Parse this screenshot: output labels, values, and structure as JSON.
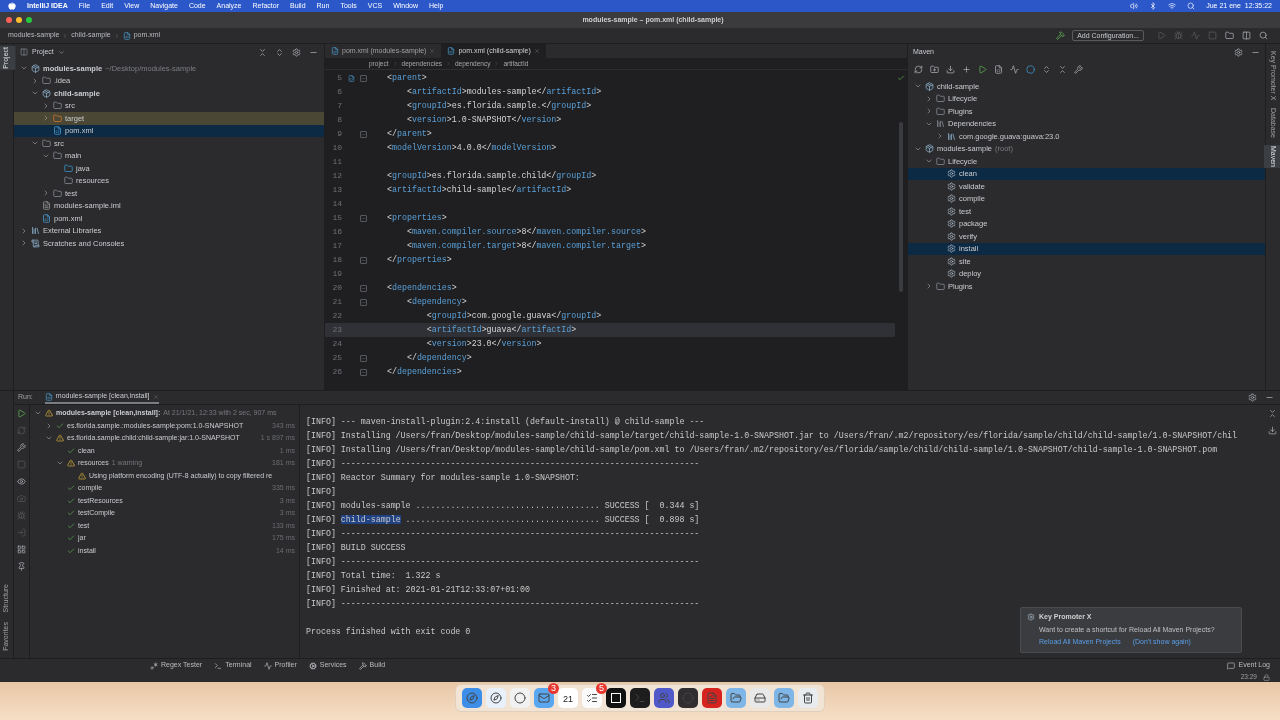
{
  "menubar": {
    "app": "IntelliJ IDEA",
    "menus": [
      "File",
      "Edit",
      "View",
      "Navigate",
      "Code",
      "Analyze",
      "Refactor",
      "Build",
      "Run",
      "Tools",
      "VCS",
      "Window",
      "Help"
    ],
    "clock": "Jue 21 ene  12:35:22"
  },
  "window": {
    "title": "modules-sample – pom.xml (child-sample)"
  },
  "navbar": {
    "crumbs": [
      {
        "label": "modules-sample",
        "kind": "module"
      },
      {
        "label": "child-sample",
        "kind": "module"
      },
      {
        "label": "pom.xml",
        "kind": "maven"
      }
    ],
    "run_config": "Add Configuration..."
  },
  "side_tabs": {
    "left_top": [
      {
        "label": "Project",
        "selected": true
      }
    ],
    "left_bottom": [
      {
        "label": "Structure",
        "selected": false
      },
      {
        "label": "Favorites",
        "selected": false
      }
    ],
    "right": [
      {
        "label": "Key Promoter X",
        "selected": false
      },
      {
        "label": "Database",
        "selected": false
      },
      {
        "label": "Maven",
        "selected": true
      }
    ]
  },
  "project": {
    "title": "Project",
    "tree": [
      {
        "label": "modules-sample",
        "hint": "~/Desktop/modules-sample",
        "kind": "module",
        "bold": true,
        "expanded": true,
        "selected": false,
        "children": [
          {
            "label": ".idea",
            "kind": "folder",
            "expanded": false,
            "selected": false
          },
          {
            "label": "child-sample",
            "kind": "module",
            "bold": true,
            "expanded": true,
            "selected": false,
            "children": [
              {
                "label": "src",
                "kind": "folder",
                "expanded": false,
                "selected": false
              },
              {
                "label": "target",
                "kind": "excluded",
                "expanded": false,
                "selected": false,
                "highlighted": true
              },
              {
                "label": "pom.xml",
                "kind": "maven",
                "selected": true
              }
            ]
          },
          {
            "label": "src",
            "kind": "folder",
            "expanded": true,
            "selected": false,
            "children": [
              {
                "label": "main",
                "kind": "folder",
                "expanded": true,
                "selected": false,
                "children": [
                  {
                    "label": "java",
                    "kind": "source",
                    "selected": false
                  },
                  {
                    "label": "resources",
                    "kind": "resources",
                    "selected": false
                  }
                ]
              },
              {
                "label": "test",
                "kind": "folder",
                "expanded": false,
                "selected": false
              }
            ]
          },
          {
            "label": "modules-sample.iml",
            "kind": "iml",
            "selected": false
          },
          {
            "label": "pom.xml",
            "kind": "maven",
            "selected": false
          }
        ]
      },
      {
        "label": "External Libraries",
        "kind": "library",
        "expanded": false,
        "selected": false
      },
      {
        "label": "Scratches and Consoles",
        "kind": "scratches",
        "expanded": false,
        "selected": false
      }
    ]
  },
  "editor": {
    "tabs": [
      {
        "label": "pom.xml (modules-sample)",
        "selected": false
      },
      {
        "label": "pom.xml (child-sample)",
        "selected": true
      }
    ],
    "breadcrumbs": [
      "project",
      "dependencies",
      "dependency",
      "artifactId"
    ],
    "lines": [
      {
        "number": "5",
        "text": "<parent>",
        "fold": true,
        "marker": true,
        "current": false
      },
      {
        "number": "6",
        "text": "    <artifactId>modules-sample</artifactId>",
        "fold": false,
        "marker": false,
        "current": false
      },
      {
        "number": "7",
        "text": "    <groupId>es.florida.sample.</groupId>",
        "fold": false,
        "marker": false,
        "current": false
      },
      {
        "number": "8",
        "text": "    <version>1.0-SNAPSHOT</version>",
        "fold": false,
        "marker": false,
        "current": false
      },
      {
        "number": "9",
        "text": "</parent>",
        "fold": true,
        "marker": false,
        "current": false
      },
      {
        "number": "10",
        "text": "<modelVersion>4.0.0</modelVersion>",
        "fold": false,
        "marker": false,
        "current": false
      },
      {
        "number": "11",
        "fold": false,
        "marker": false,
        "current": false
      },
      {
        "number": "12",
        "text": "<groupId>es.florida.sample.child</groupId>",
        "fold": false,
        "marker": false,
        "current": false
      },
      {
        "number": "13",
        "text": "<artifactId>child-sample</artifactId>",
        "fold": false,
        "marker": false,
        "current": false
      },
      {
        "number": "14",
        "fold": false,
        "marker": false,
        "current": false
      },
      {
        "number": "15",
        "text": "<properties>",
        "fold": true,
        "marker": false,
        "current": false
      },
      {
        "number": "16",
        "text": "    <maven.compiler.source>8</maven.compiler.source>",
        "fold": false,
        "marker": false,
        "current": false
      },
      {
        "number": "17",
        "text": "    <maven.compiler.target>8</maven.compiler.target>",
        "fold": false,
        "marker": false,
        "current": false
      },
      {
        "number": "18",
        "text": "</properties>",
        "fold": true,
        "marker": false,
        "current": false
      },
      {
        "number": "19",
        "fold": false,
        "marker": false,
        "current": false
      },
      {
        "number": "20",
        "text": "<dependencies>",
        "fold": true,
        "marker": false,
        "current": false
      },
      {
        "number": "21",
        "text": "    <dependency>",
        "fold": true,
        "marker": false,
        "current": false
      },
      {
        "number": "22",
        "text": "        <groupId>com.google.guava</groupId>",
        "fold": false,
        "marker": false,
        "current": false
      },
      {
        "number": "23",
        "text": "        <artifactId>guava</artifactId>",
        "fold": false,
        "marker": false,
        "current": true
      },
      {
        "number": "24",
        "text": "        <version>23.0</version>",
        "fold": false,
        "marker": false,
        "current": false
      },
      {
        "number": "25",
        "text": "    </dependency>",
        "fold": true,
        "marker": false,
        "current": false
      },
      {
        "number": "26",
        "text": "</dependencies>",
        "fold": true,
        "marker": false,
        "current": false
      }
    ]
  },
  "maven": {
    "title": "Maven",
    "tree": [
      {
        "label": "child-sample",
        "kind": "module",
        "expanded": true,
        "selected": false,
        "children": [
          {
            "label": "Lifecycle",
            "kind": "folder",
            "expanded": false,
            "selected": false
          },
          {
            "label": "Plugins",
            "kind": "folder",
            "expanded": false,
            "selected": false
          },
          {
            "label": "Dependencies",
            "kind": "deps",
            "expanded": true,
            "selected": false,
            "children": [
              {
                "label": "com.google.guava:guava:23.0",
                "kind": "library",
                "expanded": false,
                "selected": false
              }
            ]
          }
        ]
      },
      {
        "label": "modules-sample",
        "hint": "(root)",
        "kind": "module",
        "expanded": true,
        "selected": false,
        "children": [
          {
            "label": "Lifecycle",
            "kind": "folder",
            "expanded": true,
            "selected": false,
            "children": [
              {
                "label": "clean",
                "kind": "goal",
                "selected": true
              },
              {
                "label": "validate",
                "kind": "goal",
                "selected": false
              },
              {
                "label": "compile",
                "kind": "goal",
                "selected": false
              },
              {
                "label": "test",
                "kind": "goal",
                "selected": false
              },
              {
                "label": "package",
                "kind": "goal",
                "selected": false
              },
              {
                "label": "verify",
                "kind": "goal",
                "selected": false
              },
              {
                "label": "install",
                "kind": "goal",
                "selected": true
              },
              {
                "label": "site",
                "kind": "goal",
                "selected": false
              },
              {
                "label": "deploy",
                "kind": "goal",
                "selected": false
              }
            ]
          },
          {
            "label": "Plugins",
            "kind": "folder",
            "expanded": false,
            "selected": false
          }
        ]
      }
    ]
  },
  "run": {
    "label": "Run:",
    "tab": "modules-sample [clean,install]",
    "tree": [
      {
        "label": "modules-sample [clean,install]:",
        "note": "At 21/1/21, 12:33 with 2 sec, 907 ms",
        "warning": true,
        "bold": true,
        "expanded": true,
        "children": [
          {
            "label": "es.florida.sample.:modules-sample:pom:1.0-SNAPSHOT",
            "time": "343 ms",
            "warning": false,
            "expanded": false
          },
          {
            "label": "es.florida.sample.child:child-sample:jar:1.0-SNAPSHOT",
            "time": "1 s 897 ms",
            "warning": true,
            "expanded": true,
            "children": [
              {
                "label": "clean",
                "time": "1 ms",
                "warning": false
              },
              {
                "label": "resources",
                "note": "1 warning",
                "time": "181 ms",
                "warning": true,
                "expanded": true,
                "children": [
                  {
                    "label": "Using platform encoding (UTF-8 actually) to copy filtered re",
                    "warning": true
                  }
                ]
              },
              {
                "label": "compile",
                "time": "335 ms",
                "warning": false
              },
              {
                "label": "testResources",
                "time": "3 ms",
                "warning": false
              },
              {
                "label": "testCompile",
                "time": "3 ms",
                "warning": false
              },
              {
                "label": "test",
                "time": "133 ms",
                "warning": false
              },
              {
                "label": "jar",
                "time": "175 ms",
                "warning": false
              },
              {
                "label": "install",
                "time": "14 ms",
                "warning": false
              }
            ]
          }
        ]
      }
    ],
    "console": [
      {
        "kind": "plain",
        "text": "[INFO] --- maven-install-plugin:2.4:install (default-install) @ child-sample ---"
      },
      {
        "kind": "plain",
        "text": "[INFO] Installing /Users/fran/Desktop/modules-sample/child-sample/target/child-sample-1.0-SNAPSHOT.jar to /Users/fran/.m2/repository/es/florida/sample/child/child-sample/1.0-SNAPSHOT/chil"
      },
      {
        "kind": "plain",
        "text": "[INFO] Installing /Users/fran/Desktop/modules-sample/child-sample/pom.xml to /Users/fran/.m2/repository/es/florida/sample/child/child-sample/1.0-SNAPSHOT/child-sample-1.0-SNAPSHOT.pom"
      },
      {
        "kind": "plain",
        "text": "[INFO] ------------------------------------------------------------------------"
      },
      {
        "kind": "plain",
        "text": "[INFO] Reactor Summary for modules-sample 1.0-SNAPSHOT:"
      },
      {
        "kind": "plain",
        "text": "[INFO]"
      },
      {
        "kind": "plain",
        "text": "[INFO] modules-sample ..................................... SUCCESS [  0.344 s]"
      },
      {
        "kind": "selection",
        "text": "[INFO] ",
        "selected_text": "child-sample",
        "after": " ....................................... SUCCESS [  0.898 s]"
      },
      {
        "kind": "plain",
        "text": "[INFO] ------------------------------------------------------------------------"
      },
      {
        "kind": "plain",
        "text": "[INFO] BUILD SUCCESS"
      },
      {
        "kind": "plain",
        "text": "[INFO] ------------------------------------------------------------------------"
      },
      {
        "kind": "plain",
        "text": "[INFO] Total time:  1.322 s"
      },
      {
        "kind": "plain",
        "text": "[INFO] Finished at: 2021-01-21T12:33:07+01:00"
      },
      {
        "kind": "plain",
        "text": "[INFO] ------------------------------------------------------------------------"
      }
    ],
    "exit": "Process finished with exit code 0"
  },
  "notification": {
    "title": "Key Promoter X",
    "body": "Want to create a shortcut for Reload All Maven Projects?",
    "links": [
      "Reload All Maven Projects",
      "(Don't show again)"
    ]
  },
  "toolbar": [
    {
      "label": "Regex Tester",
      "kind": "regex"
    },
    {
      "label": "Terminal",
      "kind": "terminal"
    },
    {
      "label": "Profiler",
      "kind": "profiler"
    },
    {
      "label": "Services",
      "kind": "services"
    },
    {
      "label": "Build",
      "kind": "build"
    }
  ],
  "event_log": "Event Log",
  "status": "23:29",
  "dock": [
    {
      "kind": "finder"
    },
    {
      "kind": "safari"
    },
    {
      "kind": "chrome"
    },
    {
      "kind": "mail",
      "badge": "3"
    },
    {
      "kind": "calendar",
      "day": "21"
    },
    {
      "kind": "reminders",
      "badge": "5"
    },
    {
      "kind": "intellij"
    },
    {
      "kind": "terminal"
    },
    {
      "kind": "teams"
    },
    {
      "kind": "obs"
    },
    {
      "kind": "acrobat"
    },
    {
      "kind": "folder"
    },
    {
      "kind": "drive"
    },
    {
      "kind": "folder"
    },
    {
      "kind": "trash"
    }
  ]
}
